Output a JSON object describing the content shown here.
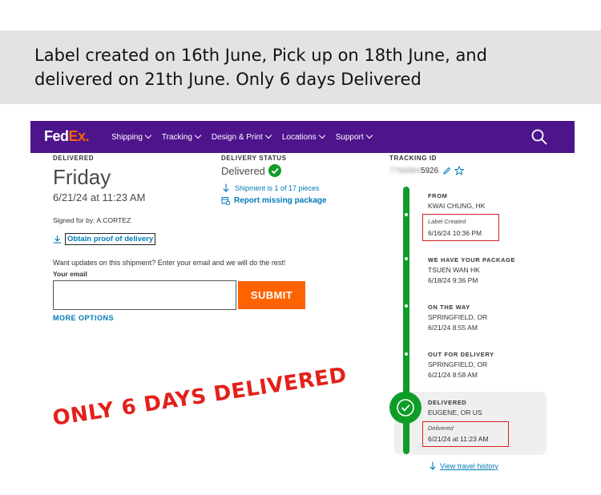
{
  "caption": {
    "line1": "Label created on 16th June, Pick up on 18th June, and",
    "line2": "delivered on 21th June. Only 6 days Delivered"
  },
  "nav": {
    "logo_fed": "Fed",
    "logo_ex": "Ex.",
    "items": [
      "Shipping",
      "Tracking",
      "Design & Print",
      "Locations",
      "Support"
    ],
    "brand_color": "#4d148c",
    "accent_color": "#ff6200"
  },
  "delivered": {
    "label": "DELIVERED",
    "day": "Friday",
    "datetime": "6/21/24 at 11:23 AM",
    "signed": "Signed for by: A.CORTEZ",
    "proof_link": "Obtain proof of delivery"
  },
  "updates": {
    "prompt": "Want updates on this shipment? Enter your email and we will do the rest!",
    "email_label": "Your email",
    "email_value": "",
    "submit_label": "SUBMIT",
    "more_options": "MORE OPTIONS"
  },
  "status": {
    "label": "DELIVERY STATUS",
    "value": "Delivered",
    "pieces": "Shipment is 1 of 17 pieces",
    "report": "Report missing package"
  },
  "tracking": {
    "label": "TRACKING ID",
    "id_hidden": "7768884",
    "id_visible": "5926"
  },
  "timeline": [
    {
      "head": "FROM",
      "line1": "KWAI CHUNG, HK",
      "note": "Label Created",
      "line2": "6/16/24 10:36 PM"
    },
    {
      "head": "WE HAVE YOUR PACKAGE",
      "line1": "TSUEN WAN HK",
      "line2": "6/18/24 9:36 PM"
    },
    {
      "head": "ON THE WAY",
      "line1": "SPRINGFIELD, OR",
      "line2": "6/21/24 8:55 AM"
    },
    {
      "head": "OUT FOR DELIVERY",
      "line1": "SPRINGFIELD, OR",
      "line2": "6/21/24 8:58 AM"
    },
    {
      "head": "DELIVERED",
      "line1": "EUGENE, OR US",
      "note": "Delivered",
      "line2": "6/21/24 at 11:23 AM"
    }
  ],
  "view_history": "View travel history",
  "stamp": "ONLY 6 DAYS DELIVERED",
  "colors": {
    "success": "#0f9d28",
    "link": "#007ab7",
    "highlight_box": "#d62020",
    "stamp": "#e3211b"
  }
}
